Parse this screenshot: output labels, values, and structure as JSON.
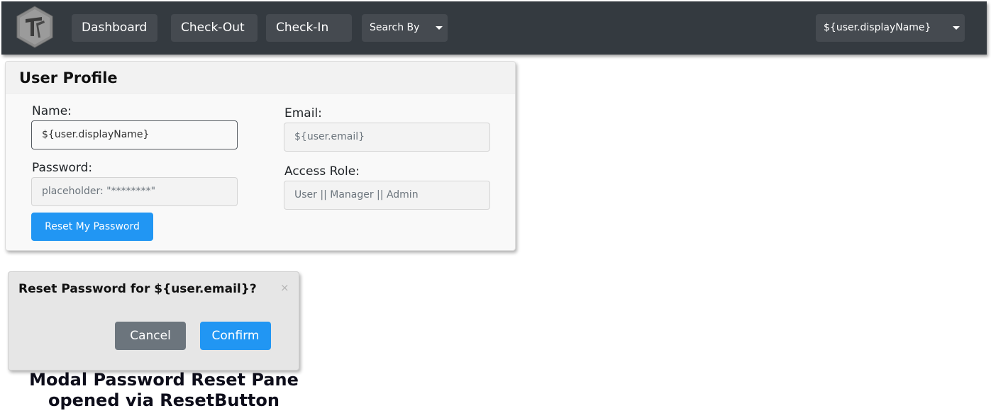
{
  "navbar": {
    "logo_icon": "anvil-hammer-logo-icon",
    "items": [
      {
        "label": "Dashboard"
      },
      {
        "label": "Check-Out"
      },
      {
        "label": "Check-In"
      }
    ],
    "search_by": {
      "label": "Search By",
      "icon": "caret-down-icon"
    },
    "user_menu": {
      "label": "${user.displayName}",
      "icon": "caret-down-icon"
    },
    "background_color": "#343a40"
  },
  "profile": {
    "title": "User Profile",
    "name": {
      "label": "Name:",
      "value": "${user.displayName}"
    },
    "email": {
      "label": "Email:",
      "value": "${user.email}"
    },
    "password": {
      "label": "Password:",
      "value": "placeholder: \"********\""
    },
    "access_role": {
      "label": "Access Role:",
      "value": "User || Manager || Admin"
    },
    "reset_button": "Reset My Password"
  },
  "modal": {
    "title": "Reset Password for ${user.email}?",
    "close_symbol": "×",
    "cancel_label": "Cancel",
    "confirm_label": "Confirm",
    "accent_color": "#2196f3",
    "secondary_color": "#6c757d"
  },
  "caption": {
    "line1": "Modal Password Reset Pane",
    "line2": "opened via ResetButton"
  }
}
